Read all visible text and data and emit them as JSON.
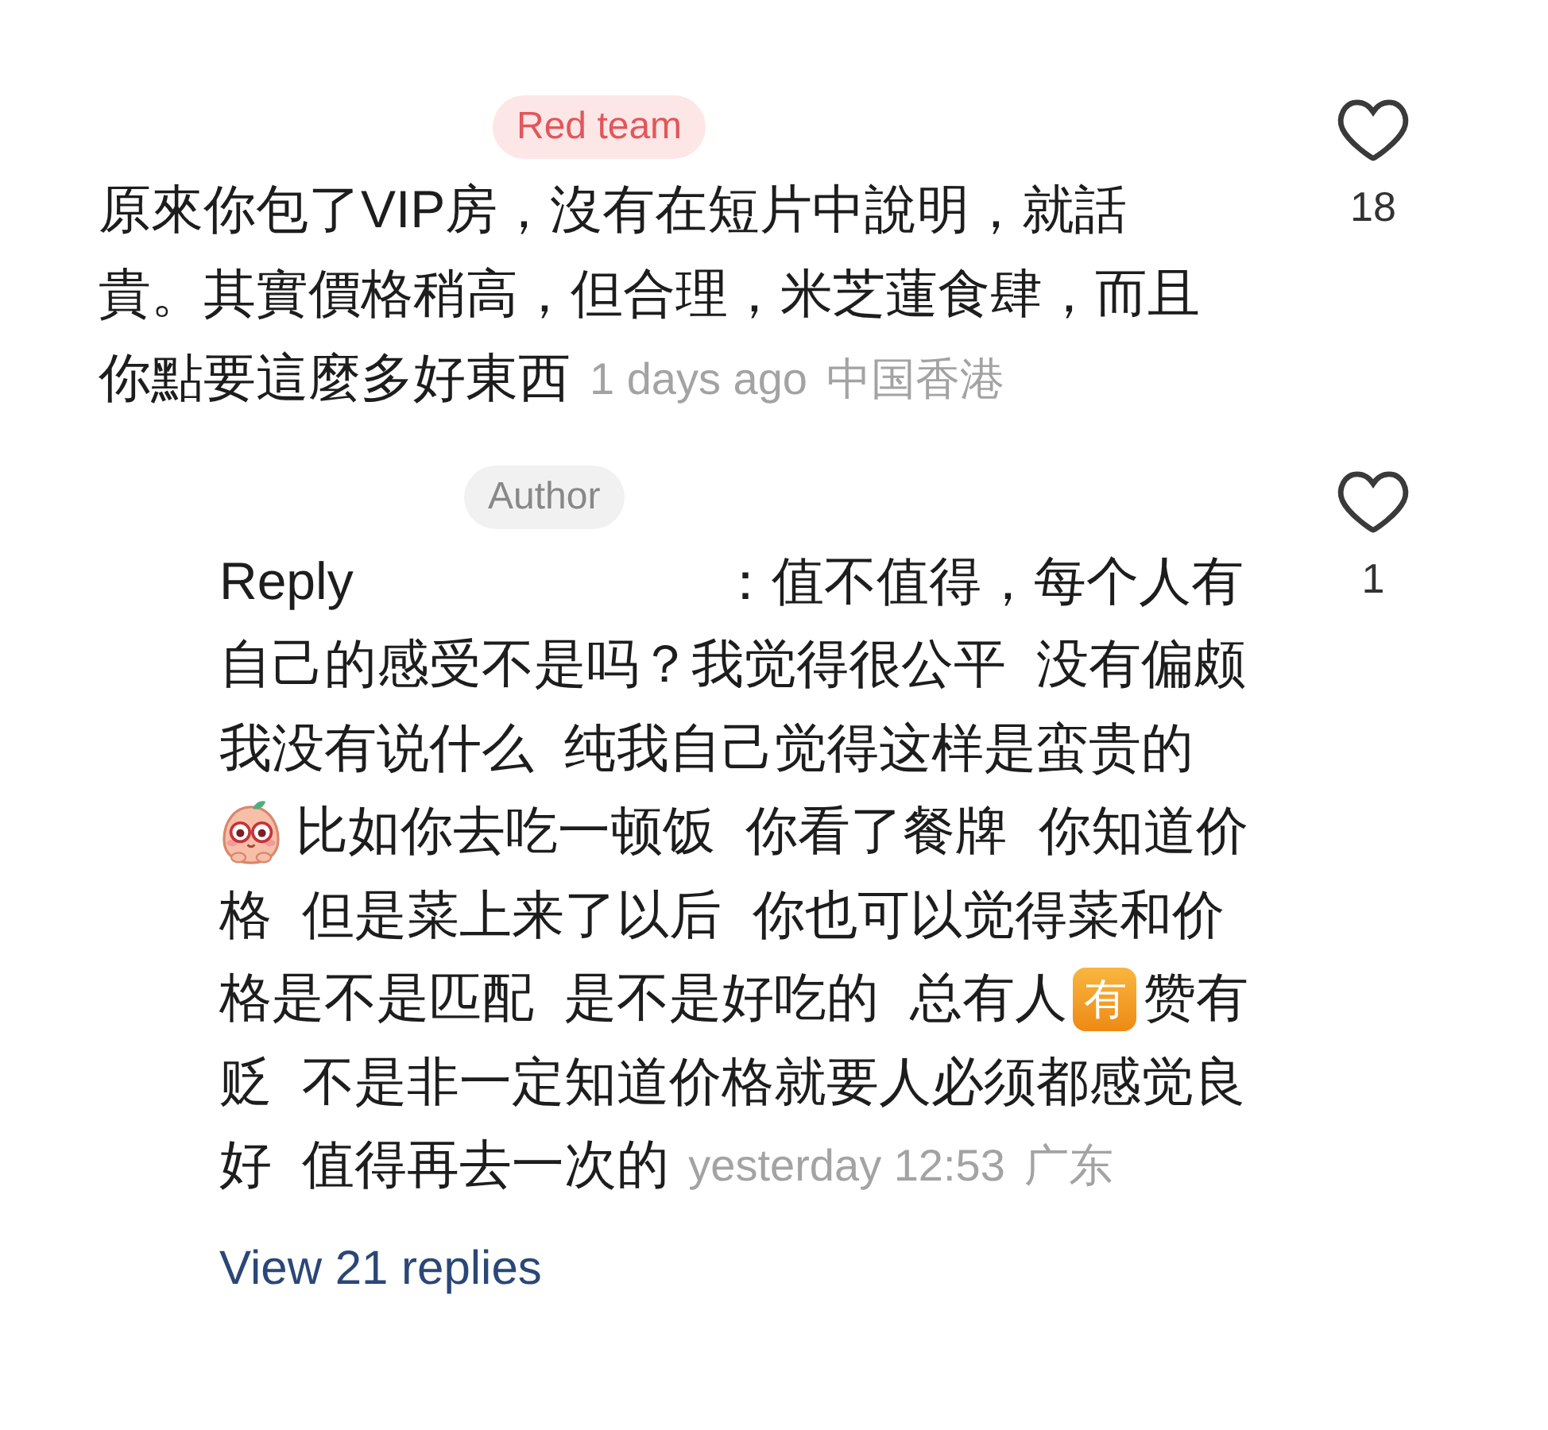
{
  "comment": {
    "badge": {
      "kind": "team",
      "text": "Red team"
    },
    "lines": [
      "原來你包了VIP房，沒有在短片中說明，就話",
      "貴。其實價格稍高，但合理，米芝蓮食肆，而且",
      "你點要這麼多好東西"
    ],
    "time": "1 days ago",
    "location": "中国香港",
    "liked": false,
    "likes": "18"
  },
  "reply": {
    "badge": {
      "kind": "author",
      "text": "Author"
    },
    "lines": [
      [
        {
          "kind": "label",
          "text": "Reply"
        },
        {
          "kind": "text",
          "text": "：值不值得，每个人有"
        }
      ],
      [
        {
          "kind": "text",
          "text": "自己的感受不是吗？我觉得很公平 没有偏颇"
        }
      ],
      [
        {
          "kind": "text",
          "text": "我没有说什么 纯我自己觉得这样是蛮贵的"
        }
      ],
      [
        {
          "kind": "sticker"
        },
        {
          "kind": "text",
          "text": "比如你去吃一顿饭 你看了餐牌 你知道价"
        }
      ],
      [
        {
          "kind": "text",
          "text": "格 但是菜上来了以后 你也可以觉得菜和价"
        }
      ],
      [
        {
          "kind": "text",
          "text": "格是不是匹配 是不是好吃的 总有人"
        },
        {
          "kind": "emoji",
          "text": "有"
        },
        {
          "kind": "text",
          "text": "赞有"
        }
      ],
      [
        {
          "kind": "text",
          "text": "贬 不是非一定知道价格就要人必须都感觉良"
        }
      ],
      [
        {
          "kind": "text",
          "text": "好 值得再去一次的"
        },
        {
          "kind": "time",
          "text": "yesterday 12:53"
        },
        {
          "kind": "location",
          "text": "广东"
        }
      ]
    ],
    "liked": false,
    "likes": "1"
  },
  "view_replies": "View 21 replies"
}
